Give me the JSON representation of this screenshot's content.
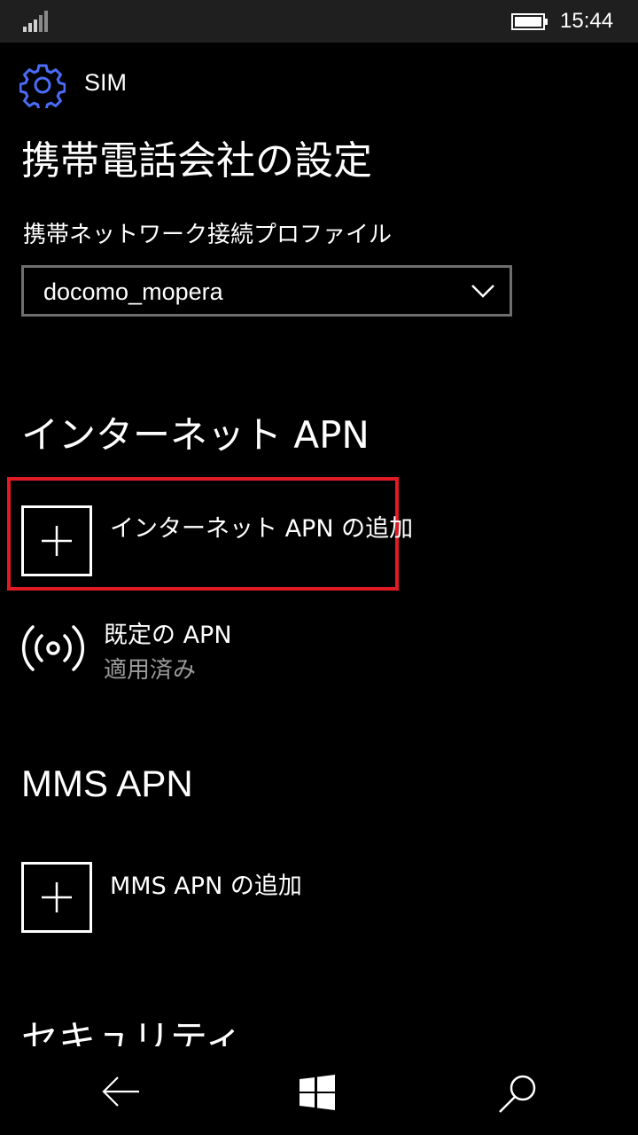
{
  "status_bar": {
    "time": "15:44",
    "icons": [
      "signal-icon",
      "battery-icon"
    ]
  },
  "header": {
    "app_label": "SIM",
    "icon": "gear-icon",
    "page_title": "携帯電話会社の設定"
  },
  "profile": {
    "label": "携帯ネットワーク接続プロファイル",
    "selected": "docomo_mopera"
  },
  "internet_apn": {
    "section_title": "インターネット APN",
    "add_label": "インターネット APN の追加",
    "default_apn": {
      "title": "既定の APN",
      "status": "適用済み",
      "icon": "broadcast-icon"
    }
  },
  "mms_apn": {
    "section_title": "MMS APN",
    "add_label": "MMS APN の追加"
  },
  "security": {
    "section_title": "セキュリティ"
  },
  "navbar": {
    "icons": [
      "back-arrow-icon",
      "windows-icon",
      "search-icon"
    ]
  },
  "colors": {
    "accent": "#4a6cf7",
    "highlight": "#e01b24",
    "secondary_text": "#9a9a9a",
    "statusbar_bg": "#1f1f1f"
  }
}
